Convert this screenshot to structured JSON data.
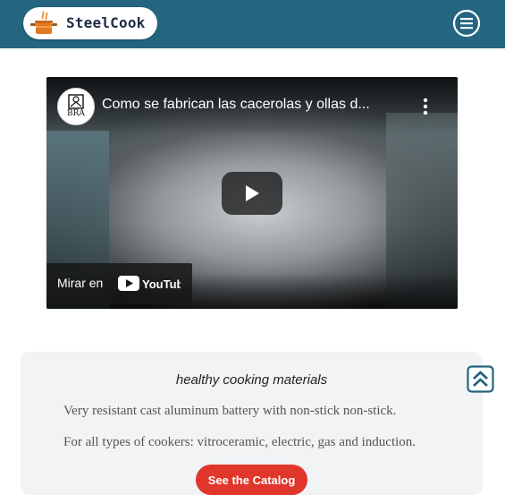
{
  "header": {
    "brand": "SteelCook",
    "logo_icon": "cooking-pot-icon",
    "menu_icon": "hamburger-menu-icon",
    "accent_color": "#246580"
  },
  "video": {
    "title": "Como se fabrican las cacerolas y ollas d...",
    "channel_badge": "BRA",
    "watch_on_label": "Mirar en",
    "watch_on_platform": "YouTube",
    "play_icon": "play-icon",
    "more_icon": "more-vertical-icon"
  },
  "card": {
    "title": "healthy cooking materials",
    "line1": "Very resistant cast aluminum battery with non-stick non-stick.",
    "line2": "For all types of cookers: vitroceramic, electric, gas and induction.",
    "button_label": "See the Catalog",
    "button_color": "#e0362b"
  },
  "scroll_top": {
    "icon": "double-chevron-up-icon",
    "color": "#246580"
  }
}
